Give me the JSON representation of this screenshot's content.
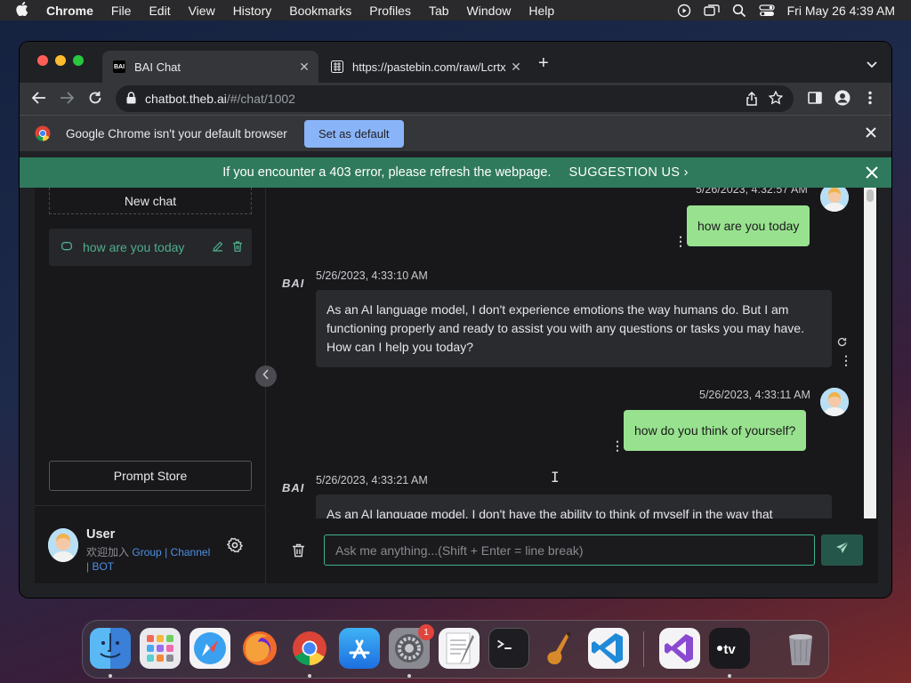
{
  "menubar": {
    "app_name": "Chrome",
    "items": [
      "File",
      "Edit",
      "View",
      "History",
      "Bookmarks",
      "Profiles",
      "Tab",
      "Window",
      "Help"
    ],
    "clock": "Fri May 26  4:39 AM"
  },
  "browser": {
    "tabs": [
      {
        "title": "BAI Chat",
        "favicon": "BAI"
      },
      {
        "title": "https://pastebin.com/raw/Lcrtx"
      }
    ],
    "url_host": "chatbot.theb.ai",
    "url_path": "/#/chat/1002",
    "infobar": {
      "message": "Google Chrome isn't your default browser",
      "button": "Set as default"
    }
  },
  "notice": {
    "message": "If you encounter a 403 error, please refresh the webpage.",
    "link": "SUGGESTION US"
  },
  "sidebar": {
    "new_chat": "New chat",
    "chats": [
      {
        "title": "how are you today"
      }
    ],
    "prompt_store": "Prompt Store",
    "user": {
      "name": "User",
      "welcome": "欢迎加入",
      "group": "Group",
      "separator": "|",
      "channel": "Channel",
      "bot": "BOT"
    }
  },
  "chat": {
    "messages": [
      {
        "role": "user",
        "time": "5/26/2023, 4:32:57 AM",
        "text": "how are you today"
      },
      {
        "role": "bot",
        "time": "5/26/2023, 4:33:10 AM",
        "text": "As an AI language model, I don't experience emotions the way humans do. But I am functioning properly and ready to assist you with any questions or tasks you may have. How can I help you today?"
      },
      {
        "role": "user",
        "time": "5/26/2023, 4:33:11 AM",
        "text": "how do you think of yourself?"
      },
      {
        "role": "bot",
        "time": "5/26/2023, 4:33:21 AM",
        "text": "As an AI language model, I don't have the ability to think of myself in the way that"
      }
    ],
    "bot_label": "BAI",
    "input_placeholder": "Ask me anything...(Shift + Enter = line break)"
  },
  "dock": {
    "apps": [
      "Finder",
      "Launchpad",
      "Safari",
      "Firefox",
      "Google Chrome",
      "App Store",
      "System Settings",
      "TextEdit",
      "Terminal",
      "GarageBand",
      "Visual Studio Code",
      "Visual Studio",
      "Apple TV",
      "Trash"
    ],
    "settings_badge": "1"
  },
  "colors": {
    "accent": "#2f7a5c",
    "user_bubble": "#98e28f",
    "link": "#4d8fe0",
    "input_border": "#3fb389"
  }
}
